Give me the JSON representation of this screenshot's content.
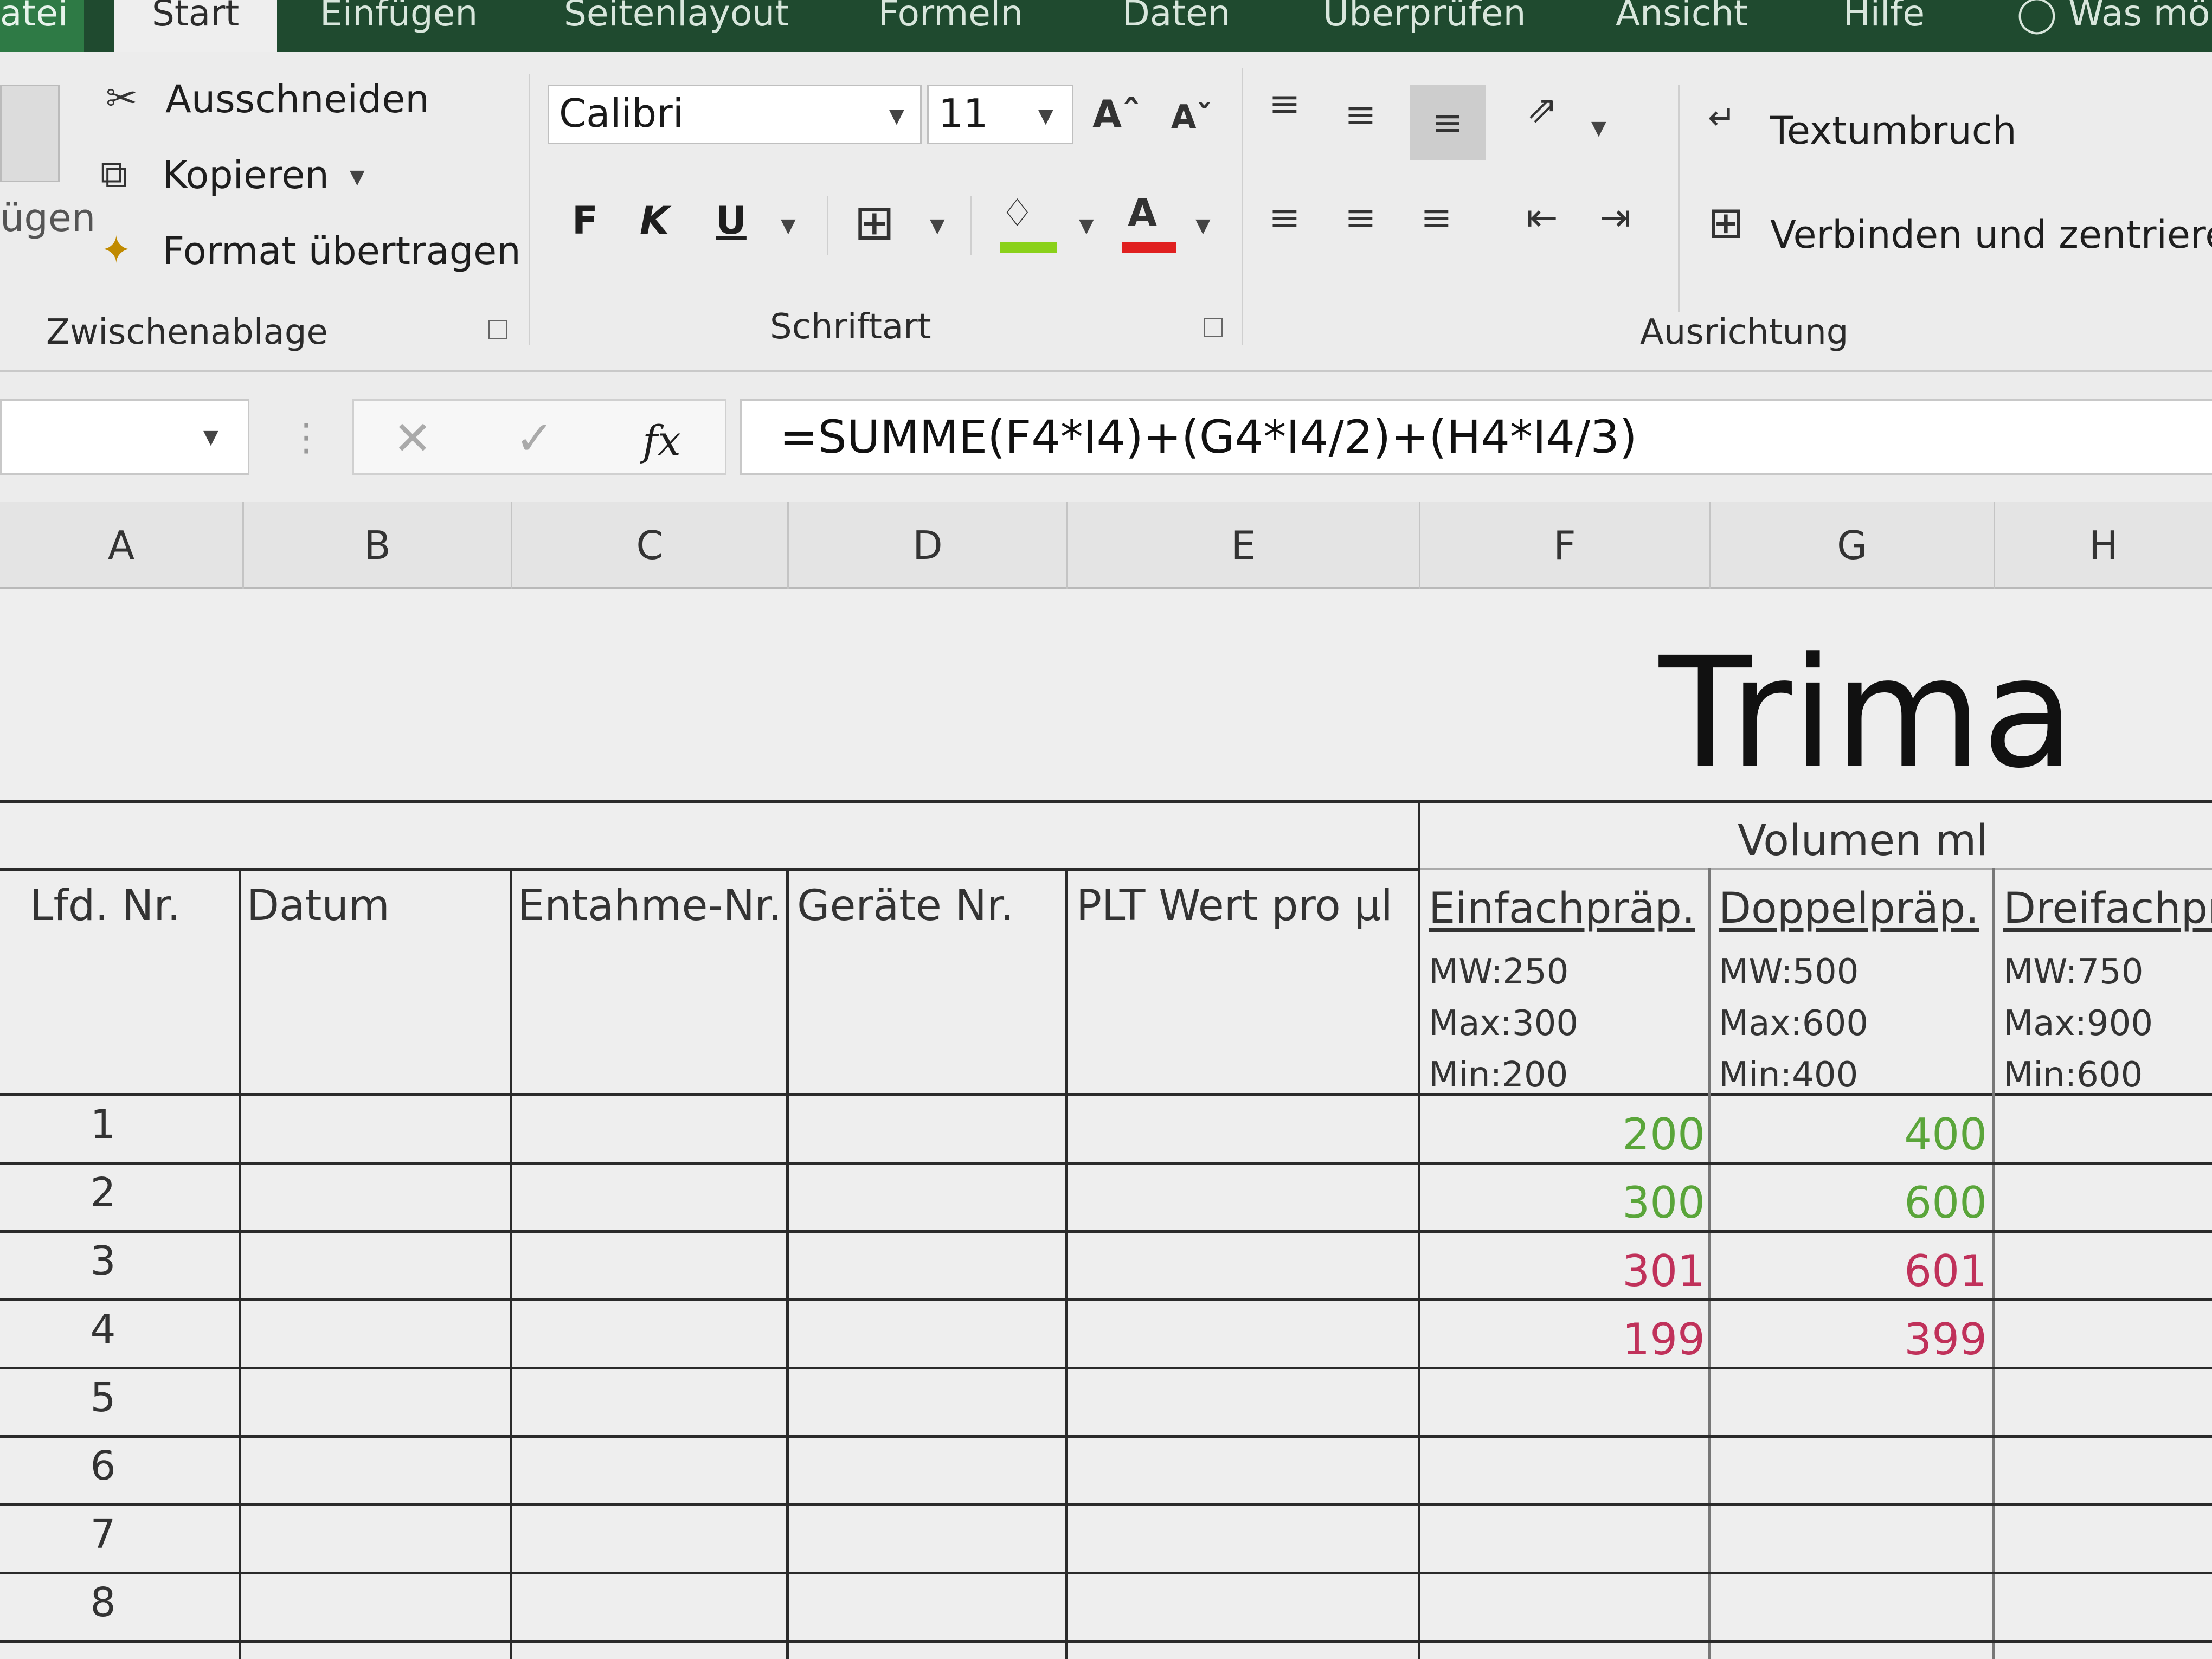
{
  "ribbon_tabs": [
    "atei",
    "Start",
    "Einfügen",
    "Seitenlayout",
    "Formeln",
    "Daten",
    "Überprüfen",
    "Ansicht",
    "Hilfe",
    "Was mö"
  ],
  "clipboard": {
    "paste_label": "ügen",
    "cut": "Ausschneiden",
    "copy": "Kopieren",
    "format_painter": "Format übertragen",
    "group_label": "Zwischenablage"
  },
  "font": {
    "family": "Calibri",
    "size": "11",
    "bold": "F",
    "italic": "K",
    "underline": "U",
    "group_label": "Schriftart",
    "fill_color": "#8ad11a",
    "font_color": "#e02020"
  },
  "alignment": {
    "wrap_text": "Textumbruch",
    "merge_center": "Verbinden und zentrieren",
    "group_label": "Ausrichtung"
  },
  "formula_bar": {
    "formula": "=SUMME(F4*I4)+(G4*I4/2)+(H4*I4/3)",
    "fx": "fx"
  },
  "columns": [
    "A",
    "B",
    "C",
    "D",
    "E",
    "F",
    "G",
    "H"
  ],
  "sheet": {
    "title": "Trima",
    "group_header": "Volumen ml",
    "headers": [
      "Lfd. Nr.",
      "Datum",
      "Entahme-Nr.",
      "Geräte Nr.",
      "PLT Wert pro µl"
    ],
    "volume_headers": [
      {
        "name": "Einfachpräp.",
        "mw": "MW:250",
        "max": "Max:300",
        "min": "Min:200"
      },
      {
        "name": "Doppelpräp.",
        "mw": "MW:500",
        "max": "Max:600",
        "min": "Min:400"
      },
      {
        "name": "Dreifachpr",
        "mw": "MW:750",
        "max": "Max:900",
        "min": "Min:600"
      }
    ],
    "rows": [
      {
        "nr": "1",
        "einfach": "200",
        "doppel": "400",
        "status": "ok"
      },
      {
        "nr": "2",
        "einfach": "300",
        "doppel": "600",
        "status": "ok"
      },
      {
        "nr": "3",
        "einfach": "301",
        "doppel": "601",
        "status": "out"
      },
      {
        "nr": "4",
        "einfach": "199",
        "doppel": "399",
        "status": "out"
      },
      {
        "nr": "5",
        "einfach": "",
        "doppel": "",
        "status": ""
      },
      {
        "nr": "6",
        "einfach": "",
        "doppel": "",
        "status": ""
      },
      {
        "nr": "7",
        "einfach": "",
        "doppel": "",
        "status": ""
      },
      {
        "nr": "8",
        "einfach": "",
        "doppel": "",
        "status": ""
      }
    ],
    "ok_color": "#5aa53a",
    "out_color": "#c0315a"
  }
}
